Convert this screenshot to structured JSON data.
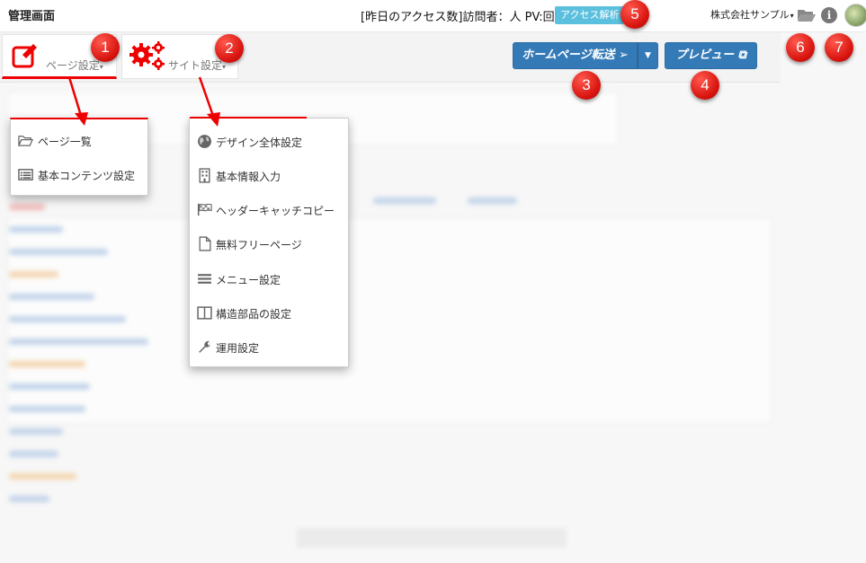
{
  "app": {
    "title": "管理画面"
  },
  "topbar": {
    "stats_label": "[昨日のアクセス数]訪問者：人 PV:回",
    "access_button": "アクセス解析",
    "company": "株式会社サンプル",
    "folder_icon": "folder-open-icon",
    "info_icon": "info-circle-icon",
    "info_glyph": "i"
  },
  "toolbar": {
    "page_settings": {
      "label": "ページ設定",
      "icon": "edit-icon"
    },
    "site_settings": {
      "label": "サイト設定",
      "icon": "gears-icon"
    },
    "transfer_button": "ホームページ転送",
    "preview_button": "プレビュー"
  },
  "page_menu": {
    "items": [
      {
        "label": "ページ一覧",
        "icon": "folder-open-icon"
      },
      {
        "label": "基本コンテンツ設定",
        "icon": "list-alt-icon"
      }
    ]
  },
  "site_menu": {
    "items": [
      {
        "label": "デザイン全体設定",
        "icon": "globe-icon"
      },
      {
        "label": "基本情報入力",
        "icon": "building-icon"
      },
      {
        "label": "ヘッダーキャッチコピー",
        "icon": "flag-checkered-icon"
      },
      {
        "label": "無料フリーページ",
        "icon": "file-icon"
      },
      {
        "label": "メニュー設定",
        "icon": "bars-icon"
      },
      {
        "label": "構造部品の設定",
        "icon": "columns-icon"
      },
      {
        "label": "運用設定",
        "icon": "wrench-icon"
      }
    ]
  },
  "markers": [
    "1",
    "2",
    "3",
    "4",
    "5",
    "6",
    "7"
  ],
  "colors": {
    "primary": "#337ab7",
    "info": "#5bc0de",
    "marker": "#e0201a",
    "highlight": "#ee0000"
  }
}
